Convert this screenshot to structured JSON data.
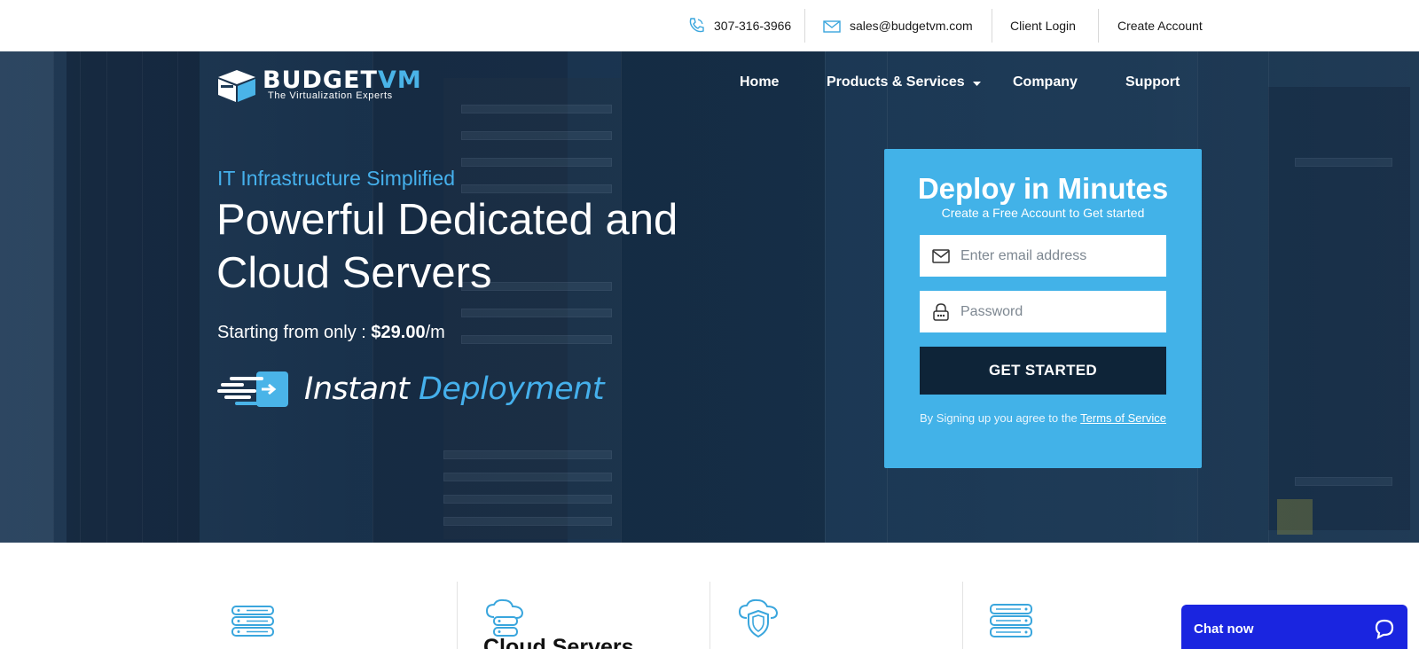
{
  "topbar": {
    "phone": "307-316-3966",
    "email": "sales@budgetvm.com",
    "client_login": "Client Login",
    "create_account": "Create Account"
  },
  "brand": {
    "name_part1": "BUDGET",
    "name_part2": "VM",
    "tagline": "The Virtualization Experts",
    "accent_color": "#45b0ec"
  },
  "nav": {
    "items": [
      {
        "label": "Home"
      },
      {
        "label": "Products & Services"
      },
      {
        "label": "Company"
      },
      {
        "label": "Support"
      }
    ]
  },
  "hero": {
    "eyebrow": "IT Infrastructure Simplified",
    "headline": "Powerful Dedicated and Cloud Servers",
    "price_prefix": "Starting from only : ",
    "price_value": "$29.00",
    "price_suffix": "/m",
    "instant_word1": "Instant",
    "instant_word2": "Deployment"
  },
  "signup": {
    "title": "Deploy in Minutes",
    "subtitle": "Create a Free Account to Get started",
    "email_placeholder": "Enter email address",
    "password_placeholder": "Password",
    "button_label": "GET STARTED",
    "terms_prefix": "By Signing up you agree to the ",
    "terms_link": "Terms of Service",
    "card_color": "#42b2e8",
    "button_color": "#0e2438"
  },
  "features": {
    "icons": [
      "server-stack-icon",
      "cloud-server-icon",
      "shield-icon",
      "storage-icon"
    ],
    "visible_title": "Cloud Servers"
  },
  "chat": {
    "label": "Chat now",
    "color": "#1a25e0"
  }
}
